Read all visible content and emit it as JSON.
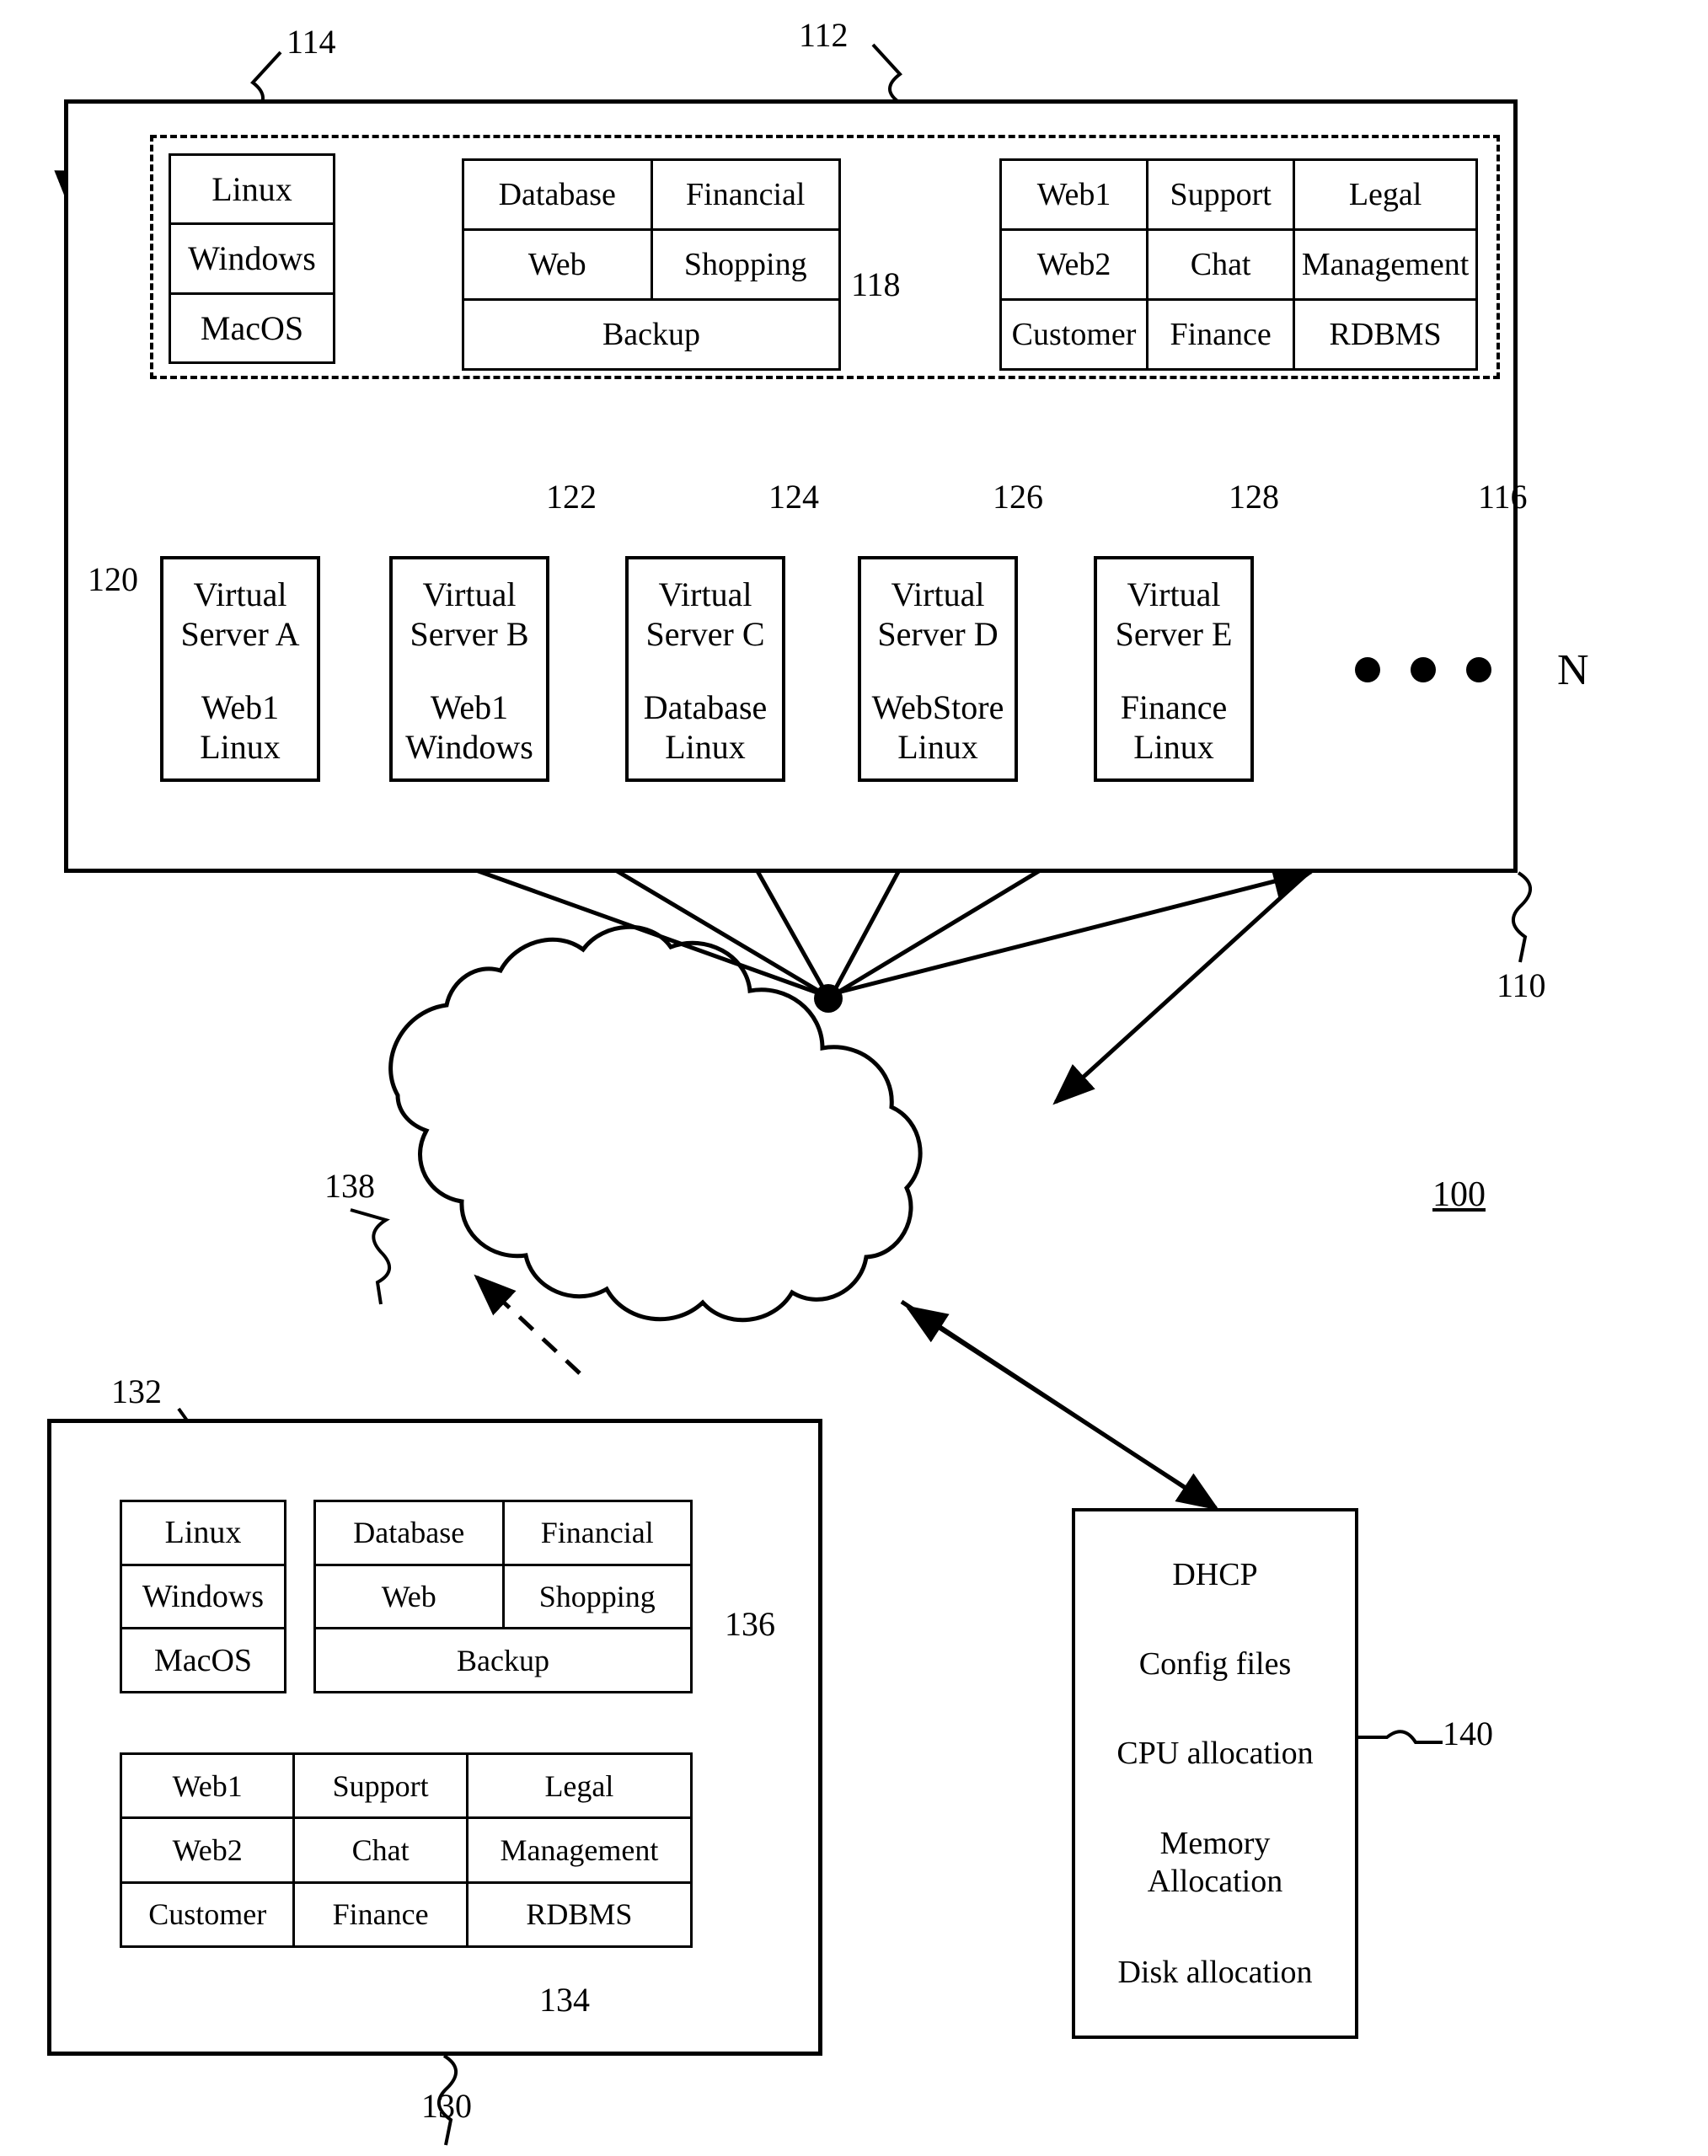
{
  "figure": {
    "label_100": "100",
    "label_110": "110",
    "label_112": "112",
    "label_114": "114",
    "label_116": "116",
    "label_118": "118",
    "label_120": "120",
    "label_122": "122",
    "label_124": "124",
    "label_126": "126",
    "label_128": "128",
    "label_130": "130",
    "label_132": "132",
    "label_134": "134",
    "label_136": "136",
    "label_138": "138",
    "label_140": "140",
    "n_label": "N"
  },
  "top_system": {
    "os_stack": {
      "items": [
        "Linux",
        "Windows",
        "MacOS"
      ]
    },
    "app_grid": {
      "rows": [
        [
          "Database",
          "Financial"
        ],
        [
          "Web",
          "Shopping"
        ]
      ],
      "full_row": "Backup"
    },
    "service_grid": {
      "rows": [
        [
          "Web1",
          "Support",
          "Legal"
        ],
        [
          "Web2",
          "Chat",
          "Management"
        ],
        [
          "Customer",
          "Finance",
          "RDBMS"
        ]
      ]
    },
    "virtual_servers": [
      {
        "name": "Virtual",
        "name2": "Server A",
        "role": "Web1",
        "os": "Linux"
      },
      {
        "name": "Virtual",
        "name2": "Server B",
        "role": "Web1",
        "os": "Windows"
      },
      {
        "name": "Virtual",
        "name2": "Server C",
        "role": "Database",
        "os": "Linux"
      },
      {
        "name": "Virtual",
        "name2": "Server D",
        "role": "WebStore",
        "os": "Linux"
      },
      {
        "name": "Virtual",
        "name2": "Server E",
        "role": "Finance",
        "os": "Linux"
      }
    ]
  },
  "bottom_repository": {
    "os_stack": {
      "items": [
        "Linux",
        "Windows",
        "MacOS"
      ]
    },
    "app_grid": {
      "rows": [
        [
          "Database",
          "Financial"
        ],
        [
          "Web",
          "Shopping"
        ]
      ],
      "full_row": "Backup"
    },
    "service_grid": {
      "rows": [
        [
          "Web1",
          "Support",
          "Legal"
        ],
        [
          "Web2",
          "Chat",
          "Management"
        ],
        [
          "Customer",
          "Finance",
          "RDBMS"
        ]
      ]
    }
  },
  "config_server": {
    "items": [
      "DHCP",
      "Config files",
      "CPU allocation",
      "Memory\nAllocation",
      "Disk allocation"
    ],
    "items_display": [
      "DHCP",
      "Config files",
      "CPU allocation",
      "Memory Allocation",
      "Disk allocation"
    ]
  },
  "colors": {
    "ink": "#000000",
    "paper": "#ffffff"
  }
}
